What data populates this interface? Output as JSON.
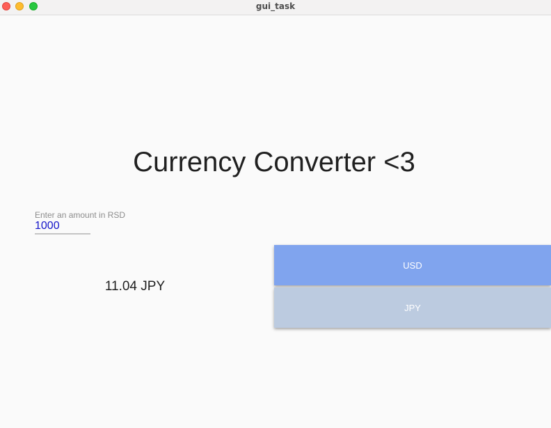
{
  "window": {
    "title": "gui_task"
  },
  "app": {
    "heading": "Currency Converter <3",
    "amount_field": {
      "label": "Enter an amount in RSD",
      "value": "1000"
    },
    "result": "11.04 JPY",
    "buttons": {
      "usd": "USD",
      "jpy": "JPY"
    }
  },
  "colors": {
    "usd_button": "#80a4ee",
    "jpy_button": "#bccbe0",
    "input_text": "#1313c9"
  }
}
